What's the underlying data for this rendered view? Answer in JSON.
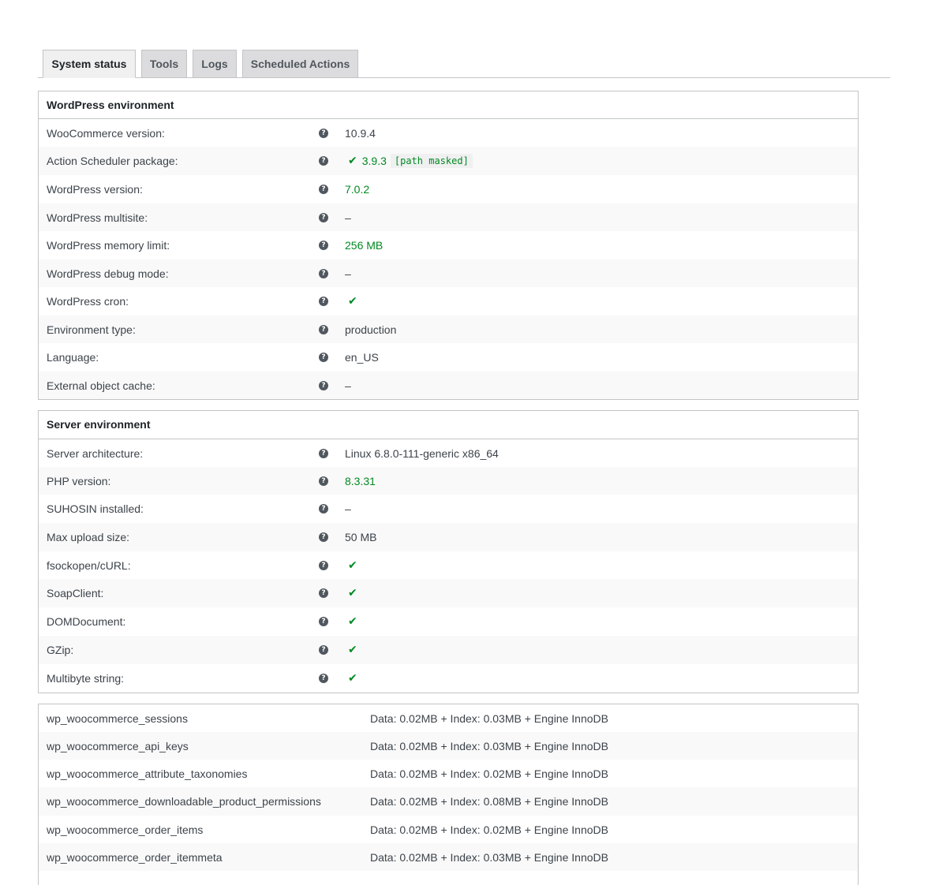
{
  "tabs": [
    {
      "label": "System status",
      "active": true
    },
    {
      "label": "Tools",
      "active": false
    },
    {
      "label": "Logs",
      "active": false
    },
    {
      "label": "Scheduled Actions",
      "active": false
    }
  ],
  "wordpress_env": {
    "title": "WordPress environment",
    "rows": {
      "wc_version": {
        "label": "WooCommerce version:",
        "value": "10.9.4"
      },
      "action_scheduler": {
        "label": "Action Scheduler package:",
        "value": "3.9.3",
        "path": "[path masked]"
      },
      "wp_version": {
        "label": "WordPress version:",
        "value": "7.0.2"
      },
      "multisite": {
        "label": "WordPress multisite:",
        "value": "–"
      },
      "memory_limit": {
        "label": "WordPress memory limit:",
        "value": "256 MB"
      },
      "debug_mode": {
        "label": "WordPress debug mode:",
        "value": "–"
      },
      "cron": {
        "label": "WordPress cron:"
      },
      "env_type": {
        "label": "Environment type:",
        "value": "production"
      },
      "language": {
        "label": "Language:",
        "value": "en_US"
      },
      "object_cache": {
        "label": "External object cache:",
        "value": "–"
      }
    }
  },
  "server_env": {
    "title": "Server environment",
    "rows": {
      "architecture": {
        "label": "Server architecture:",
        "value": "Linux 6.8.0-111-generic x86_64"
      },
      "php_version": {
        "label": "PHP version:",
        "value": "8.3.31"
      },
      "suhosin": {
        "label": "SUHOSIN installed:",
        "value": "–"
      },
      "max_upload": {
        "label": "Max upload size:",
        "value": "50 MB"
      },
      "fsockopen": {
        "label": "fsockopen/cURL:"
      },
      "soapclient": {
        "label": "SoapClient:"
      },
      "domdocument": {
        "label": "DOMDocument:"
      },
      "gzip": {
        "label": "GZip:"
      },
      "multibyte": {
        "label": "Multibyte string:"
      }
    }
  },
  "database_tables": [
    {
      "name": "wp_woocommerce_sessions",
      "info": "Data: 0.02MB + Index: 0.03MB + Engine InnoDB"
    },
    {
      "name": "wp_woocommerce_api_keys",
      "info": "Data: 0.02MB + Index: 0.03MB + Engine InnoDB"
    },
    {
      "name": "wp_woocommerce_attribute_taxonomies",
      "info": "Data: 0.02MB + Index: 0.02MB + Engine InnoDB"
    },
    {
      "name": "wp_woocommerce_downloadable_product_permissions",
      "info": "Data: 0.02MB + Index: 0.08MB + Engine InnoDB"
    },
    {
      "name": "wp_woocommerce_order_items",
      "info": "Data: 0.02MB + Index: 0.02MB + Engine InnoDB"
    },
    {
      "name": "wp_woocommerce_order_itemmeta",
      "info": "Data: 0.02MB + Index: 0.03MB + Engine InnoDB"
    }
  ],
  "icons": {
    "help": "?",
    "check": "✔"
  },
  "colors": {
    "success": "#008a20",
    "border": "#c3c4c7",
    "row_alt": "#f9f9f9"
  }
}
